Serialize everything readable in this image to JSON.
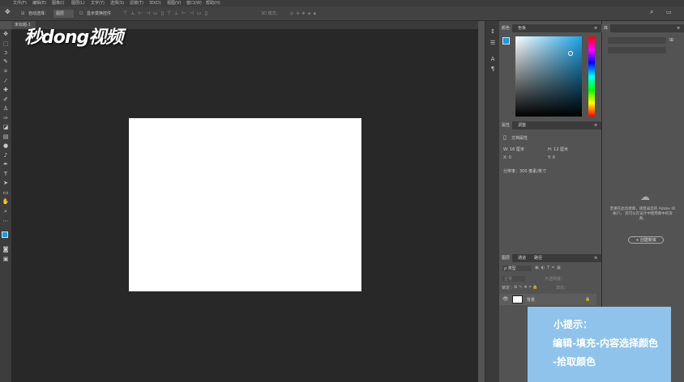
{
  "menubar": {
    "items": [
      "文件(F)",
      "编辑(E)",
      "图像(I)",
      "图层(L)",
      "文字(Y)",
      "选择(S)",
      "滤镜(T)",
      "3D(D)",
      "视图(V)",
      "窗口(W)",
      "帮助(H)"
    ]
  },
  "options": {
    "auto_select_label": "自动选择：",
    "auto_select_value": "图层",
    "show_transform_label": "显示变换控件",
    "mode_label": "3D 模式："
  },
  "document": {
    "tab_label": "未标题-1"
  },
  "logo": {
    "text": "秒dong视频"
  },
  "color_panel": {
    "tab_color": "颜色",
    "tab_swatches": "色板",
    "foreground": "#1e96d8",
    "background": "#ffffff"
  },
  "properties_panel": {
    "tab_properties": "属性",
    "tab_adjustments": "调整",
    "section_title": "文档属性",
    "width": "W:  16 厘米",
    "height": "H:  12 厘米",
    "x": "X:  0",
    "y": "Y:  0",
    "resolution": "分辨率：300 像素/英寸"
  },
  "layers_panel": {
    "tab_layers": "图层",
    "tab_channels": "通道",
    "tab_paths": "路径",
    "kind_label": "ρ 类型",
    "blend_mode": "正常",
    "opacity_label": "不透明度：",
    "lock_label": "锁定：",
    "fill_label": "填充：",
    "layer_name": "背景"
  },
  "libraries_panel": {
    "tab": "库",
    "message": "若要在此创建库，请登录您的 Adobe ID 帐户。 您可以在设计中使用库中的资源。",
    "create_button": "+ 创建新库"
  },
  "tip": {
    "title": "小提示：",
    "line1": "编辑-填充-内容选择颜色",
    "line2": "-拾取颜色"
  }
}
